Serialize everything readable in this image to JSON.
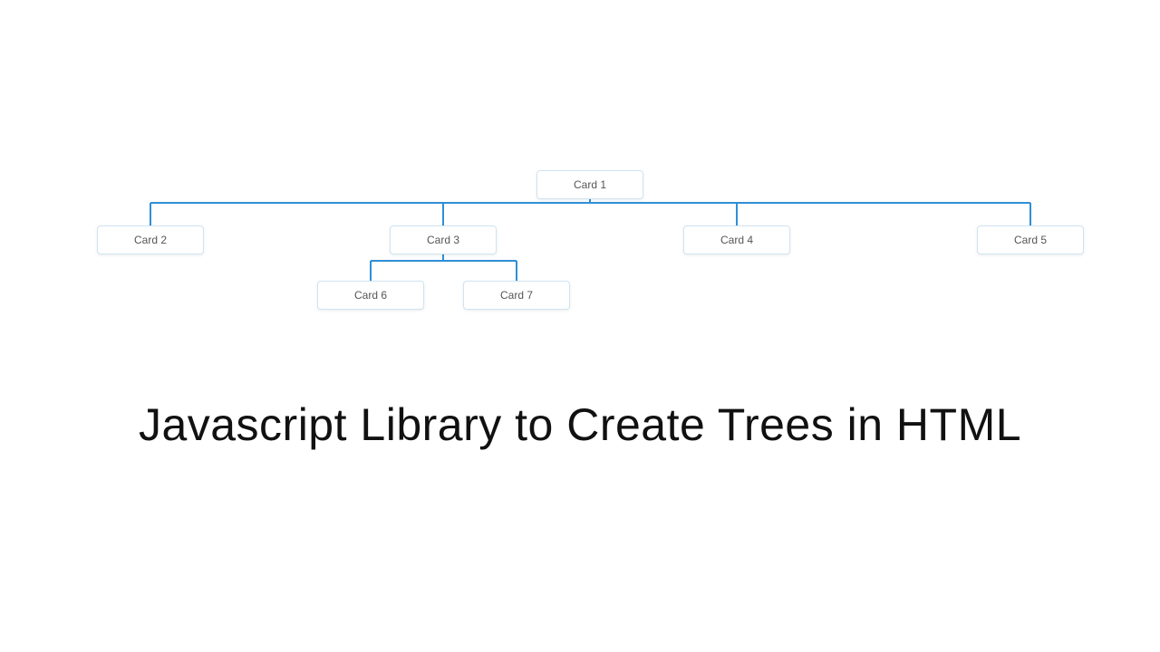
{
  "headline": "Javascript Library to Create Trees in HTML",
  "nodes": {
    "card1": "Card 1",
    "card2": "Card 2",
    "card3": "Card 3",
    "card4": "Card 4",
    "card5": "Card 5",
    "card6": "Card 6",
    "card7": "Card 7"
  },
  "colors": {
    "connector": "#2f8fd6",
    "nodeBorder": "#cfe4f2"
  }
}
